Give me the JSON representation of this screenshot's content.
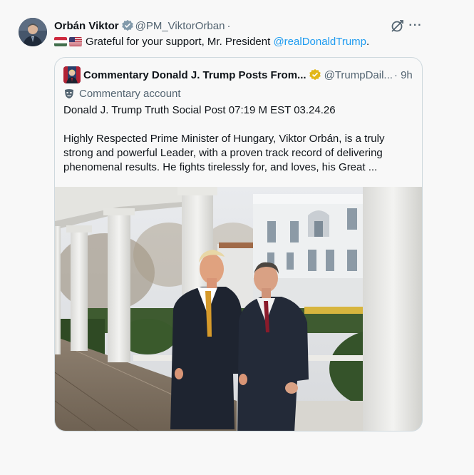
{
  "tweet": {
    "author_name": "Orbán Viktor",
    "author_handle": "@PM_ViktorOrban",
    "separator": "·",
    "text_prefix": "Grateful for your support, Mr. President ",
    "mention": "@realDonaldTrump",
    "text_suffix": ".",
    "flags": [
      "hungary-flag-icon",
      "usa-flag-icon"
    ],
    "more_label": "···"
  },
  "quote": {
    "author_name": "Commentary Donald J. Trump Posts From...",
    "author_handle": "@TrumpDail...",
    "time": "· 9h",
    "account_label": "Commentary account",
    "line1": "Donald J. Trump Truth Social Post 07:19 M EST 03.24.26",
    "line2": "Highly Respected Prime Minister of Hungary, Viktor Orbán, is a truly strong and powerful Leader, with a proven track record of delivering phenomenal results. He fights tirelessly for, and loves, his Great ...",
    "colors": {
      "verified_gold": "#e2b719",
      "verified_blue": "#1d9bf0"
    }
  }
}
